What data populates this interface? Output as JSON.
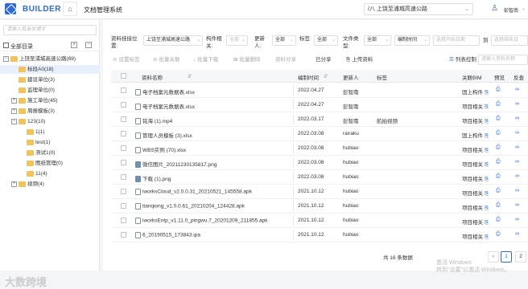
{
  "header": {
    "brand": "BUILDER",
    "app_title": "文档管理系统",
    "project": "/八 上饶至浦城高速公路",
    "user": "彭智南"
  },
  "sidebar": {
    "search_placeholder": "请输入目录关键字",
    "title": "全部目录",
    "tree": [
      {
        "label": "上饶至浦城高速公路(89)",
        "level": 0,
        "toggle": "−",
        "folder": true
      },
      {
        "label": "标段A0(18)",
        "level": 1,
        "toggle": "",
        "folder": true,
        "selected": true
      },
      {
        "label": "建设单位(3)",
        "level": 1,
        "toggle": "",
        "folder": true
      },
      {
        "label": "监理单位(0)",
        "level": 1,
        "toggle": "",
        "folder": true
      },
      {
        "label": "施工单位(45)",
        "level": 1,
        "toggle": "+",
        "folder": true
      },
      {
        "label": "周报模板(3)",
        "level": 1,
        "toggle": "+",
        "folder": true
      },
      {
        "label": "123(10)",
        "level": 1,
        "toggle": "−",
        "folder": true
      },
      {
        "label": "1(1)",
        "level": 2,
        "toggle": "",
        "folder": true
      },
      {
        "label": "test(1)",
        "level": 2,
        "toggle": "",
        "folder": true
      },
      {
        "label": "测试1(0)",
        "level": 2,
        "toggle": "",
        "folder": true
      },
      {
        "label": "图纸管理(0)",
        "level": 2,
        "toggle": "",
        "folder": true
      },
      {
        "label": "11(4)",
        "level": 2,
        "toggle": "",
        "folder": true
      },
      {
        "label": "视频(4)",
        "level": 1,
        "toggle": "+",
        "folder": true
      }
    ],
    "watermark": "大数跨境"
  },
  "filters": {
    "doc_type_label": "资料挂接位置:",
    "doc_type_value": "上饶至浦城高速公路",
    "component_label": "构件相关:",
    "component_value": "全部",
    "editor_label": "更新人:",
    "editor_value": "全部",
    "tag_label": "标签:",
    "tag_value": "全部",
    "filetype_label": "文件类型:",
    "filetype_value": "全部",
    "time_value": "编制时间",
    "start_placeholder": "选择开始日期",
    "to_label": "到",
    "end_placeholder": "选择结束日"
  },
  "toolbar": {
    "set_tag": "设置标签",
    "batch_link": "批量关联",
    "batch_download": "批量下载",
    "batch_delete": "批量删除",
    "share": "资料分享",
    "shared": "已分享",
    "upload": "上传资料",
    "list_control": "列表控制",
    "search_placeholder": "请输入资料名称"
  },
  "table": {
    "headers": [
      "资料名称",
      "编制时间",
      "更新人",
      "标签",
      "关联BIM",
      "预览",
      "反查"
    ],
    "rows": [
      {
        "name": "电子档案元数据表.xlsx",
        "date": "2022.04.27",
        "user": "彭智南",
        "tag": "",
        "bim": "固上构件",
        "img": false
      },
      {
        "name": "电子档案元数据表.xlsx",
        "date": "2022.04.27",
        "user": "彭智南",
        "tag": "",
        "bim": "项目相关",
        "img": false
      },
      {
        "name": "铭海 (1).mp4",
        "date": "2022.03.17",
        "user": "彭智南",
        "tag": "航拍视频",
        "bim": "项目相关",
        "img": false
      },
      {
        "name": "管理人员模板 (3).xlsx",
        "date": "2022.03.08",
        "user": "rairaku",
        "tag": "",
        "bim": "固上构件",
        "img": false
      },
      {
        "name": "WBS实例 (70).xlsx",
        "date": "2022.03.08",
        "user": "hubiao",
        "tag": "",
        "bim": "项目相关",
        "img": false
      },
      {
        "name": "微信图片_20211230135817.png",
        "date": "2022.03.08",
        "user": "hubiao",
        "tag": "",
        "bim": "项目相关",
        "img": true
      },
      {
        "name": "下载 (1).png",
        "date": "2022.03.08",
        "user": "hubiao",
        "tag": "",
        "bim": "项目相关",
        "img": true
      },
      {
        "name": "iworksCloud_v2.0.0.31_20210521_145558.apk",
        "date": "2021.10.12",
        "user": "hubiao",
        "tag": "",
        "bim": "项目相关",
        "img": false
      },
      {
        "name": "tianqiong_v1.0.0.61_20210204_124428.apk",
        "date": "2021.10.12",
        "user": "hubiao",
        "tag": "",
        "bim": "项目相关",
        "img": false
      },
      {
        "name": "iworksEntp_v1.11.0_pingwu.7_20201209_211855.apk",
        "date": "2021.10.12",
        "user": "hubiao",
        "tag": "",
        "bim": "项目相关",
        "img": false
      },
      {
        "name": "6_20190515_173843.ipa",
        "date": "2021.10.12",
        "user": "hubiao",
        "tag": "",
        "bim": "项目相关",
        "img": false
      }
    ]
  },
  "pagination": {
    "total": "共 18 条数据",
    "current": "1",
    "next": "2"
  },
  "os_watermark": "激活 Windows\n转到\"设置\"以激活 Windows。",
  "colors": {
    "accent": "#2f6bd8",
    "folder": "#f2c35a"
  }
}
